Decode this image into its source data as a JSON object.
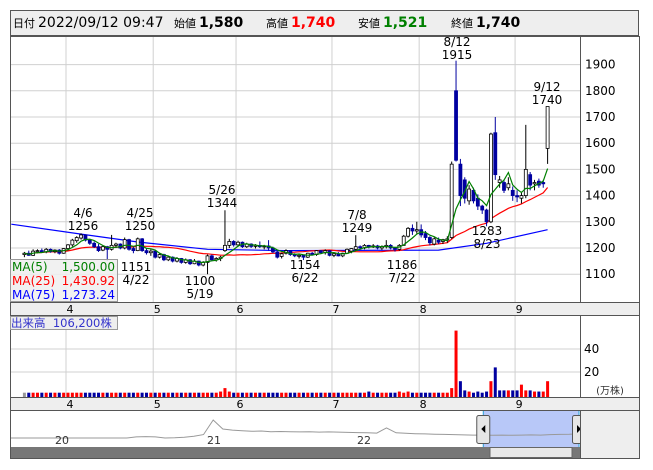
{
  "header": {
    "date_label": "日付",
    "date_value": "2022/09/12 09:47",
    "open_label": "始値",
    "open_value": "1,580",
    "high_label": "高値",
    "high_value": "1,740",
    "low_label": "安値",
    "low_value": "1,521",
    "close_label": "終値",
    "close_value": "1,740"
  },
  "colors": {
    "up_volume": "#ff0000",
    "down_volume": "#0000a0",
    "flat_volume": "#999999",
    "candle_down": "#0000a0",
    "ma5": "#008000",
    "ma25": "#ff0000",
    "ma75": "#0000ff",
    "high": "#ff0000",
    "low": "#008000"
  },
  "ma_legend": [
    {
      "label": "MA(5)",
      "value": "1,500.00"
    },
    {
      "label": "MA(25)",
      "value": "1,430.92"
    },
    {
      "label": "MA(75)",
      "value": "1,273.24"
    }
  ],
  "volume_legend": {
    "label": "出来高",
    "value": "106,200株"
  },
  "annotations": {
    "a1": {
      "date": "4/6",
      "price": "1256"
    },
    "a2": {
      "date": "4/25",
      "price": "1250"
    },
    "a3": {
      "date": "5/26",
      "price": "1344"
    },
    "a4": {
      "date": "7/8",
      "price": "1249"
    },
    "a5": {
      "date": "8/12",
      "price": "1915"
    },
    "a6": {
      "date": "9/12",
      "price": "1740"
    },
    "b1": {
      "price": "1151",
      "date": "4/22"
    },
    "b2": {
      "price": "1100",
      "date": "5/19"
    },
    "b3": {
      "price": "1154",
      "date": "6/22"
    },
    "b4": {
      "price": "1186",
      "date": "7/22"
    },
    "b5": {
      "price": "1283",
      "date": "8/23"
    }
  },
  "navigator": {
    "labels": [
      "20",
      "21",
      "22"
    ],
    "values": [
      1100,
      1100,
      1100,
      1100,
      1100,
      1100,
      1100,
      1100,
      1100,
      1100,
      1100,
      1100,
      1100,
      1150,
      1160,
      1150,
      1100,
      1110,
      1130,
      1180,
      1250,
      1900,
      1500,
      1450,
      1420,
      1400,
      1410,
      1380,
      1390,
      1380,
      1370,
      1380,
      1360,
      1370,
      1360,
      1350,
      1340,
      1330,
      1320,
      1550,
      1330,
      1310,
      1290,
      1280,
      1270,
      1260,
      1250,
      1240,
      1230,
      1230,
      1220,
      1230,
      1220,
      1230,
      1240,
      1230,
      1250,
      1260,
      1270,
      1290
    ],
    "selection_start_fraction": 0.83,
    "selection_end_fraction": 1.0
  },
  "chart_data": {
    "type": "candlestick",
    "price_axis": {
      "ticks": [
        1100,
        1200,
        1300,
        1400,
        1500,
        1600,
        1700,
        1800,
        1900
      ],
      "ylim": [
        995,
        2005
      ]
    },
    "volume_axis": {
      "ticks": [
        20,
        40
      ],
      "unit_label": "(万株)",
      "ylim": [
        0,
        69
      ]
    },
    "month_labels": [
      {
        "label": "4",
        "index": 10
      },
      {
        "label": "5",
        "index": 30
      },
      {
        "label": "6",
        "index": 49
      },
      {
        "label": "7",
        "index": 71
      },
      {
        "label": "8",
        "index": 91
      },
      {
        "label": "9",
        "index": 113
      }
    ],
    "ohlc": [
      [
        1175,
        1185,
        1165,
        1180
      ],
      [
        1180,
        1190,
        1170,
        1172
      ],
      [
        1172,
        1195,
        1170,
        1188
      ],
      [
        1188,
        1195,
        1180,
        1190
      ],
      [
        1190,
        1198,
        1182,
        1185
      ],
      [
        1185,
        1200,
        1180,
        1195
      ],
      [
        1195,
        1198,
        1182,
        1186
      ],
      [
        1186,
        1195,
        1180,
        1192
      ],
      [
        1192,
        1196,
        1175,
        1180
      ],
      [
        1180,
        1200,
        1178,
        1198
      ],
      [
        1198,
        1215,
        1190,
        1212
      ],
      [
        1212,
        1235,
        1205,
        1230
      ],
      [
        1228,
        1245,
        1220,
        1240
      ],
      [
        1238,
        1256,
        1232,
        1250
      ],
      [
        1250,
        1252,
        1225,
        1230
      ],
      [
        1230,
        1235,
        1212,
        1218
      ],
      [
        1218,
        1225,
        1200,
        1205
      ],
      [
        1205,
        1215,
        1185,
        1190
      ],
      [
        1192,
        1210,
        1188,
        1205
      ],
      [
        1205,
        1208,
        1151,
        1195
      ],
      [
        1195,
        1250,
        1190,
        1210
      ],
      [
        1210,
        1220,
        1200,
        1215
      ],
      [
        1215,
        1218,
        1195,
        1200
      ],
      [
        1200,
        1240,
        1195,
        1232
      ],
      [
        1232,
        1235,
        1190,
        1195
      ],
      [
        1198,
        1205,
        1180,
        1190
      ],
      [
        1190,
        1240,
        1188,
        1235
      ],
      [
        1235,
        1238,
        1185,
        1190
      ],
      [
        1190,
        1200,
        1175,
        1182
      ],
      [
        1182,
        1195,
        1170,
        1188
      ],
      [
        1188,
        1192,
        1160,
        1165
      ],
      [
        1165,
        1180,
        1160,
        1175
      ],
      [
        1175,
        1178,
        1150,
        1155
      ],
      [
        1155,
        1170,
        1150,
        1165
      ],
      [
        1165,
        1168,
        1145,
        1150
      ],
      [
        1150,
        1165,
        1145,
        1160
      ],
      [
        1160,
        1162,
        1140,
        1145
      ],
      [
        1145,
        1160,
        1140,
        1155
      ],
      [
        1155,
        1158,
        1135,
        1140
      ],
      [
        1140,
        1158,
        1138,
        1150
      ],
      [
        1150,
        1152,
        1130,
        1135
      ],
      [
        1135,
        1150,
        1130,
        1145
      ],
      [
        1145,
        1175,
        1100,
        1170
      ],
      [
        1170,
        1175,
        1150,
        1155
      ],
      [
        1155,
        1165,
        1148,
        1160
      ],
      [
        1160,
        1170,
        1150,
        1165
      ],
      [
        1190,
        1344,
        1185,
        1210
      ],
      [
        1210,
        1235,
        1200,
        1225
      ],
      [
        1225,
        1230,
        1205,
        1212
      ],
      [
        1212,
        1228,
        1205,
        1222
      ],
      [
        1222,
        1225,
        1200,
        1205
      ],
      [
        1205,
        1220,
        1200,
        1215
      ],
      [
        1215,
        1218,
        1200,
        1206
      ],
      [
        1206,
        1215,
        1198,
        1210
      ],
      [
        1210,
        1225,
        1200,
        1205
      ],
      [
        1205,
        1212,
        1195,
        1208
      ],
      [
        1208,
        1230,
        1190,
        1200
      ],
      [
        1200,
        1205,
        1180,
        1185
      ],
      [
        1185,
        1190,
        1160,
        1165
      ],
      [
        1168,
        1182,
        1160,
        1178
      ],
      [
        1180,
        1195,
        1175,
        1190
      ],
      [
        1190,
        1192,
        1170,
        1175
      ],
      [
        1175,
        1180,
        1165,
        1170
      ],
      [
        1170,
        1178,
        1160,
        1172
      ],
      [
        1172,
        1175,
        1154,
        1165
      ],
      [
        1165,
        1182,
        1162,
        1180
      ],
      [
        1180,
        1185,
        1172,
        1175
      ],
      [
        1175,
        1192,
        1170,
        1190
      ],
      [
        1190,
        1192,
        1178,
        1182
      ],
      [
        1182,
        1195,
        1175,
        1190
      ],
      [
        1190,
        1192,
        1168,
        1172
      ],
      [
        1172,
        1180,
        1165,
        1178
      ],
      [
        1178,
        1185,
        1168,
        1170
      ],
      [
        1170,
        1182,
        1165,
        1180
      ],
      [
        1180,
        1198,
        1178,
        1195
      ],
      [
        1188,
        1200,
        1180,
        1198
      ],
      [
        1195,
        1249,
        1190,
        1205
      ],
      [
        1205,
        1210,
        1195,
        1200
      ],
      [
        1200,
        1215,
        1195,
        1210
      ],
      [
        1210,
        1212,
        1198,
        1205
      ],
      [
        1205,
        1215,
        1200,
        1208
      ],
      [
        1208,
        1212,
        1195,
        1200
      ],
      [
        1200,
        1210,
        1192,
        1205
      ],
      [
        1205,
        1230,
        1198,
        1210
      ],
      [
        1210,
        1215,
        1195,
        1200
      ],
      [
        1200,
        1205,
        1186,
        1195
      ],
      [
        1195,
        1215,
        1190,
        1210
      ],
      [
        1210,
        1250,
        1208,
        1245
      ],
      [
        1245,
        1280,
        1240,
        1275
      ],
      [
        1275,
        1290,
        1250,
        1265
      ],
      [
        1265,
        1300,
        1255,
        1270
      ],
      [
        1270,
        1290,
        1240,
        1250
      ],
      [
        1255,
        1265,
        1230,
        1240
      ],
      [
        1240,
        1245,
        1210,
        1220
      ],
      [
        1215,
        1240,
        1210,
        1235
      ],
      [
        1230,
        1240,
        1215,
        1222
      ],
      [
        1225,
        1235,
        1215,
        1232
      ],
      [
        1230,
        1245,
        1220,
        1235
      ],
      [
        1240,
        1530,
        1235,
        1520
      ],
      [
        1800,
        1915,
        1530,
        1535
      ],
      [
        1520,
        1540,
        1360,
        1400
      ],
      [
        1460,
        1470,
        1370,
        1390
      ],
      [
        1380,
        1440,
        1365,
        1425
      ],
      [
        1420,
        1430,
        1370,
        1380
      ],
      [
        1390,
        1405,
        1345,
        1360
      ],
      [
        1360,
        1365,
        1330,
        1345
      ],
      [
        1345,
        1350,
        1283,
        1300
      ],
      [
        1300,
        1640,
        1295,
        1635
      ],
      [
        1640,
        1700,
        1460,
        1480
      ],
      [
        1450,
        1475,
        1430,
        1460
      ],
      [
        1450,
        1460,
        1410,
        1420
      ],
      [
        1430,
        1470,
        1420,
        1445
      ],
      [
        1420,
        1435,
        1380,
        1400
      ],
      [
        1400,
        1420,
        1375,
        1395
      ],
      [
        1390,
        1410,
        1370,
        1400
      ],
      [
        1400,
        1670,
        1390,
        1500
      ],
      [
        1480,
        1490,
        1420,
        1440
      ],
      [
        1445,
        1460,
        1420,
        1450
      ],
      [
        1455,
        1465,
        1430,
        1440
      ],
      [
        1450,
        1460,
        1430,
        1445
      ],
      [
        1580,
        1740,
        1521,
        1740
      ]
    ],
    "volume": [
      2,
      2,
      2,
      2,
      2,
      2,
      2,
      2,
      2,
      2,
      2,
      2,
      2,
      2,
      2,
      2,
      2,
      2,
      2,
      2,
      2,
      2,
      2,
      2,
      2,
      2,
      2,
      2,
      2,
      2,
      2,
      2,
      2,
      2,
      2,
      2,
      2,
      2,
      2,
      2,
      2,
      2,
      2,
      2,
      2,
      3,
      6,
      3,
      2,
      2,
      2,
      2,
      2,
      2,
      2,
      2,
      2,
      2,
      2,
      2,
      2,
      2,
      2,
      2,
      2,
      2,
      2,
      2,
      2,
      2,
      2,
      2,
      2,
      2,
      2,
      2,
      2,
      2,
      2,
      3,
      2,
      2,
      2,
      2,
      2,
      2,
      3,
      2,
      3,
      2,
      2,
      2,
      2,
      2,
      2,
      2,
      2,
      2,
      6,
      56,
      12,
      4,
      3,
      2,
      3,
      2,
      3,
      12,
      24,
      4,
      4,
      4,
      4,
      4,
      9,
      4,
      4,
      3,
      3,
      3,
      12
    ],
    "ma75_anchors": [
      [
        -3,
        1291
      ],
      [
        13,
        1253
      ],
      [
        26,
        1223
      ],
      [
        42,
        1195
      ],
      [
        60,
        1190
      ],
      [
        95,
        1192
      ],
      [
        106,
        1218
      ],
      [
        120,
        1270
      ]
    ]
  }
}
